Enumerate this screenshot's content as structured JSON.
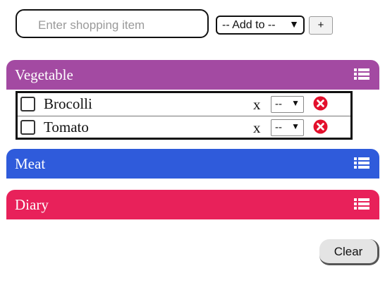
{
  "add_bar": {
    "input_placeholder": "Enter shopping item",
    "input_value": "",
    "category_select": "-- Add to --",
    "add_button_label": "+"
  },
  "categories": [
    {
      "name": "Vegetable",
      "color": "#a34aa2",
      "items": [
        {
          "name": "Brocolli",
          "checked": false,
          "x_label": "x",
          "quantity": "--"
        },
        {
          "name": "Tomato",
          "checked": false,
          "x_label": "x",
          "quantity": "--"
        }
      ]
    },
    {
      "name": "Meat",
      "color": "#2f5bdb",
      "items": []
    },
    {
      "name": "Diary",
      "color": "#e8215a",
      "items": []
    }
  ],
  "icons": {
    "list": "list-icon",
    "remove": "remove-circle-icon",
    "dropdown": "caret-down-icon"
  },
  "footer": {
    "clear_button_label": "Clear"
  }
}
